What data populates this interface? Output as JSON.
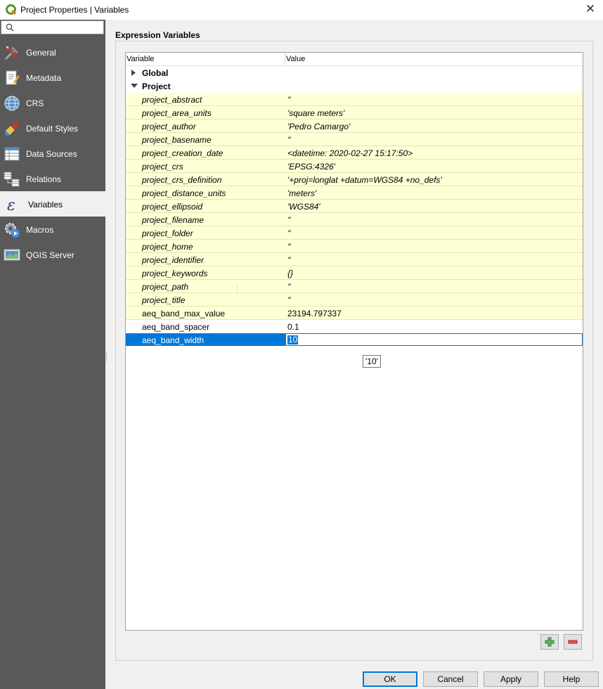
{
  "window": {
    "title": "Project Properties | Variables",
    "close_icon": "close-icon"
  },
  "sidebar": {
    "search": {
      "placeholder": "",
      "value": ""
    },
    "items": [
      {
        "label": "General",
        "icon": "tools-icon"
      },
      {
        "label": "Metadata",
        "icon": "metadata-icon"
      },
      {
        "label": "CRS",
        "icon": "globe-icon"
      },
      {
        "label": "Default Styles",
        "icon": "brush-icon"
      },
      {
        "label": "Data Sources",
        "icon": "table-icon"
      },
      {
        "label": "Relations",
        "icon": "relations-icon"
      },
      {
        "label": "Variables",
        "icon": "epsilon-icon",
        "active": true
      },
      {
        "label": "Macros",
        "icon": "macro-gear-icon"
      },
      {
        "label": "QGIS Server",
        "icon": "server-icon"
      }
    ]
  },
  "main": {
    "section_title": "Expression Variables",
    "columns": {
      "variable": "Variable",
      "value": "Value"
    },
    "groups": {
      "global": "Global",
      "project": "Project"
    },
    "readonly_rows": [
      {
        "name": "project_abstract",
        "value": "''"
      },
      {
        "name": "project_area_units",
        "value": "'square meters'"
      },
      {
        "name": "project_author",
        "value": "'Pedro Camargo'"
      },
      {
        "name": "project_basename",
        "value": "''"
      },
      {
        "name": "project_creation_date",
        "value": "<datetime: 2020-02-27 15:17:50>"
      },
      {
        "name": "project_crs",
        "value": "'EPSG:4326'"
      },
      {
        "name": "project_crs_definition",
        "value": "'+proj=longlat +datum=WGS84 +no_defs'"
      },
      {
        "name": "project_distance_units",
        "value": "'meters'"
      },
      {
        "name": "project_ellipsoid",
        "value": "'WGS84'"
      },
      {
        "name": "project_filename",
        "value": "''"
      },
      {
        "name": "project_folder",
        "value": "''"
      },
      {
        "name": "project_home",
        "value": "''"
      },
      {
        "name": "project_identifier",
        "value": "''"
      },
      {
        "name": "project_keywords",
        "value": "{}"
      },
      {
        "name": "project_path",
        "value": "''"
      },
      {
        "name": "project_title",
        "value": "''"
      }
    ],
    "custom_rows": [
      {
        "name": "aeq_band_max_value",
        "value": "23194.797337",
        "highlight": true
      },
      {
        "name": "aeq_band_spacer",
        "value": "0.1",
        "highlight": false
      }
    ],
    "editing_row": {
      "name": "aeq_band_width",
      "value": "10"
    },
    "tooltip": "'10'",
    "add_icon": "plus-icon",
    "remove_icon": "minus-icon"
  },
  "buttons": {
    "ok": "OK",
    "cancel": "Cancel",
    "apply": "Apply",
    "help": "Help"
  }
}
